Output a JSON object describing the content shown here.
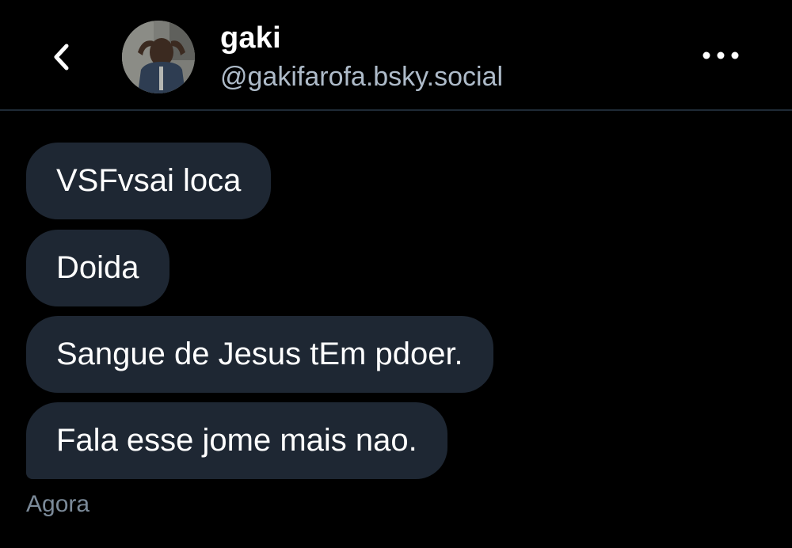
{
  "header": {
    "back_icon": "chevron-left-icon",
    "display_name": "gaki",
    "handle": "@gakifarofa.bsky.social",
    "more_icon": "ellipsis-horizontal-icon"
  },
  "messages": [
    {
      "text": "VSFvsai loca"
    },
    {
      "text": "Doida"
    },
    {
      "text": "Sangue de Jesus tEm pdoer."
    },
    {
      "text": "Fala esse jome mais nao."
    }
  ],
  "timestamp": "Agora",
  "colors": {
    "background": "#000000",
    "bubble": "#1e2733",
    "handle": "#aebbc9",
    "timestamp": "#7b8a99",
    "divider": "#1f2a36"
  }
}
